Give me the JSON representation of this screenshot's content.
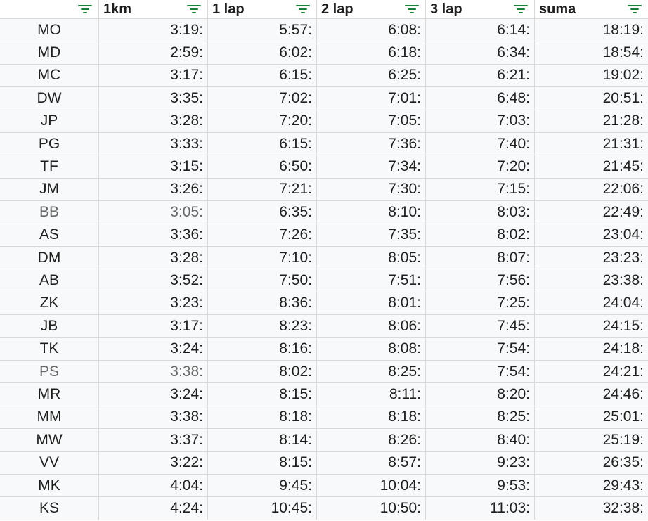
{
  "columns": [
    {
      "label": "",
      "filter_icon": "filter-icon"
    },
    {
      "label": "1km",
      "filter_icon": "filter-icon"
    },
    {
      "label": "1 lap",
      "filter_icon": "filter-icon"
    },
    {
      "label": "2 lap",
      "filter_icon": "filter-icon"
    },
    {
      "label": "3 lap",
      "filter_icon": "filter-icon"
    },
    {
      "label": "suma",
      "filter_icon": "filter-icon"
    }
  ],
  "colors": {
    "filter_icon": "#188038",
    "grid": "#d9d9d9",
    "muted_text": "#666666"
  },
  "rows": [
    {
      "name": "MO",
      "km1": "3:19:",
      "lap1": "5:57:",
      "lap2": "6:08:",
      "lap3": "6:14:",
      "suma": "18:19:",
      "muted": false
    },
    {
      "name": "MD",
      "km1": "2:59:",
      "lap1": "6:02:",
      "lap2": "6:18:",
      "lap3": "6:34:",
      "suma": "18:54:",
      "muted": false
    },
    {
      "name": "MC",
      "km1": "3:17:",
      "lap1": "6:15:",
      "lap2": "6:25:",
      "lap3": "6:21:",
      "suma": "19:02:",
      "muted": false
    },
    {
      "name": "DW",
      "km1": "3:35:",
      "lap1": "7:02:",
      "lap2": "7:01:",
      "lap3": "6:48:",
      "suma": "20:51:",
      "muted": false
    },
    {
      "name": "JP",
      "km1": "3:28:",
      "lap1": "7:20:",
      "lap2": "7:05:",
      "lap3": "7:03:",
      "suma": "21:28:",
      "muted": false
    },
    {
      "name": "PG",
      "km1": "3:33:",
      "lap1": "6:15:",
      "lap2": "7:36:",
      "lap3": "7:40:",
      "suma": "21:31:",
      "muted": false
    },
    {
      "name": "TF",
      "km1": "3:15:",
      "lap1": "6:50:",
      "lap2": "7:34:",
      "lap3": "7:20:",
      "suma": "21:45:",
      "muted": false
    },
    {
      "name": "JM",
      "km1": "3:26:",
      "lap1": "7:21:",
      "lap2": "7:30:",
      "lap3": "7:15:",
      "suma": "22:06:",
      "muted": false
    },
    {
      "name": "BB",
      "km1": "3:05:",
      "lap1": "6:35:",
      "lap2": "8:10:",
      "lap3": "8:03:",
      "suma": "22:49:",
      "muted": true
    },
    {
      "name": "AS",
      "km1": "3:36:",
      "lap1": "7:26:",
      "lap2": "7:35:",
      "lap3": "8:02:",
      "suma": "23:04:",
      "muted": false
    },
    {
      "name": "DM",
      "km1": "3:28:",
      "lap1": "7:10:",
      "lap2": "8:05:",
      "lap3": "8:07:",
      "suma": "23:23:",
      "muted": false
    },
    {
      "name": "AB",
      "km1": "3:52:",
      "lap1": "7:50:",
      "lap2": "7:51:",
      "lap3": "7:56:",
      "suma": "23:38:",
      "muted": false
    },
    {
      "name": "ZK",
      "km1": "3:23:",
      "lap1": "8:36:",
      "lap2": "8:01:",
      "lap3": "7:25:",
      "suma": "24:04:",
      "muted": false
    },
    {
      "name": "JB",
      "km1": "3:17:",
      "lap1": "8:23:",
      "lap2": "8:06:",
      "lap3": "7:45:",
      "suma": "24:15:",
      "muted": false
    },
    {
      "name": "TK",
      "km1": "3:24:",
      "lap1": "8:16:",
      "lap2": "8:08:",
      "lap3": "7:54:",
      "suma": "24:18:",
      "muted": false
    },
    {
      "name": "PS",
      "km1": "3:38:",
      "lap1": "8:02:",
      "lap2": "8:25:",
      "lap3": "7:54:",
      "suma": "24:21:",
      "muted": true
    },
    {
      "name": "MR",
      "km1": "3:24:",
      "lap1": "8:15:",
      "lap2": "8:11:",
      "lap3": "8:20:",
      "suma": "24:46:",
      "muted": false
    },
    {
      "name": "MM",
      "km1": "3:38:",
      "lap1": "8:18:",
      "lap2": "8:18:",
      "lap3": "8:25:",
      "suma": "25:01:",
      "muted": false
    },
    {
      "name": "MW",
      "km1": "3:37:",
      "lap1": "8:14:",
      "lap2": "8:26:",
      "lap3": "8:40:",
      "suma": "25:19:",
      "muted": false
    },
    {
      "name": "VV",
      "km1": "3:22:",
      "lap1": "8:15:",
      "lap2": "8:57:",
      "lap3": "9:23:",
      "suma": "26:35:",
      "muted": false
    },
    {
      "name": "MK",
      "km1": "4:04:",
      "lap1": "9:45:",
      "lap2": "10:04:",
      "lap3": "9:53:",
      "suma": "29:43:",
      "muted": false
    },
    {
      "name": "KS",
      "km1": "4:24:",
      "lap1": "10:45:",
      "lap2": "10:50:",
      "lap3": "11:03:",
      "suma": "32:38:",
      "muted": false
    }
  ]
}
